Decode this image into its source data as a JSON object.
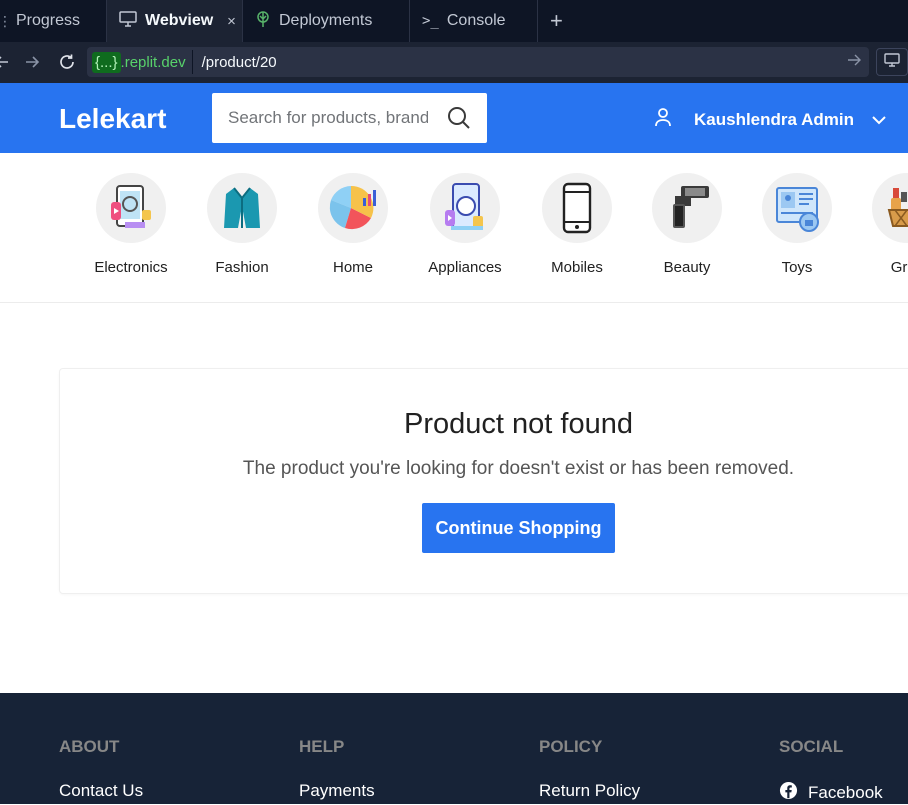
{
  "ide": {
    "tabs": [
      {
        "label": "Progress",
        "icon": "grip-icon"
      },
      {
        "label": "Webview",
        "icon": "monitor-icon",
        "close": "×"
      },
      {
        "label": "Deployments",
        "icon": "deploy-icon"
      },
      {
        "label": "Console",
        "icon": "terminal-icon"
      }
    ],
    "add_tab": "+",
    "url": {
      "domain_highlight": "{...}",
      "domain_suffix": ".replit.dev",
      "path": "/product/20"
    }
  },
  "header": {
    "logo": "Lelekart",
    "search_placeholder": "Search for products, brands and more",
    "user_name": "Kaushlendra Admin",
    "brand_color": "#2874f0"
  },
  "categories": [
    {
      "label": "Electronics",
      "icon": "electronics-icon"
    },
    {
      "label": "Fashion",
      "icon": "fashion-icon"
    },
    {
      "label": "Home",
      "icon": "home-icon"
    },
    {
      "label": "Appliances",
      "icon": "appliances-icon"
    },
    {
      "label": "Mobiles",
      "icon": "mobiles-icon"
    },
    {
      "label": "Beauty",
      "icon": "beauty-icon"
    },
    {
      "label": "Toys",
      "icon": "toys-icon"
    },
    {
      "label": "Groc",
      "icon": "grocery-icon"
    }
  ],
  "main": {
    "title": "Product not found",
    "message": "The product you're looking for doesn't exist or has been removed.",
    "button": "Continue Shopping"
  },
  "footer": {
    "columns": [
      {
        "heading": "ABOUT",
        "link": "Contact Us"
      },
      {
        "heading": "HELP",
        "link": "Payments"
      },
      {
        "heading": "POLICY",
        "link": "Return Policy"
      },
      {
        "heading": "SOCIAL",
        "link": "Facebook"
      }
    ],
    "bg_color": "#172337"
  }
}
